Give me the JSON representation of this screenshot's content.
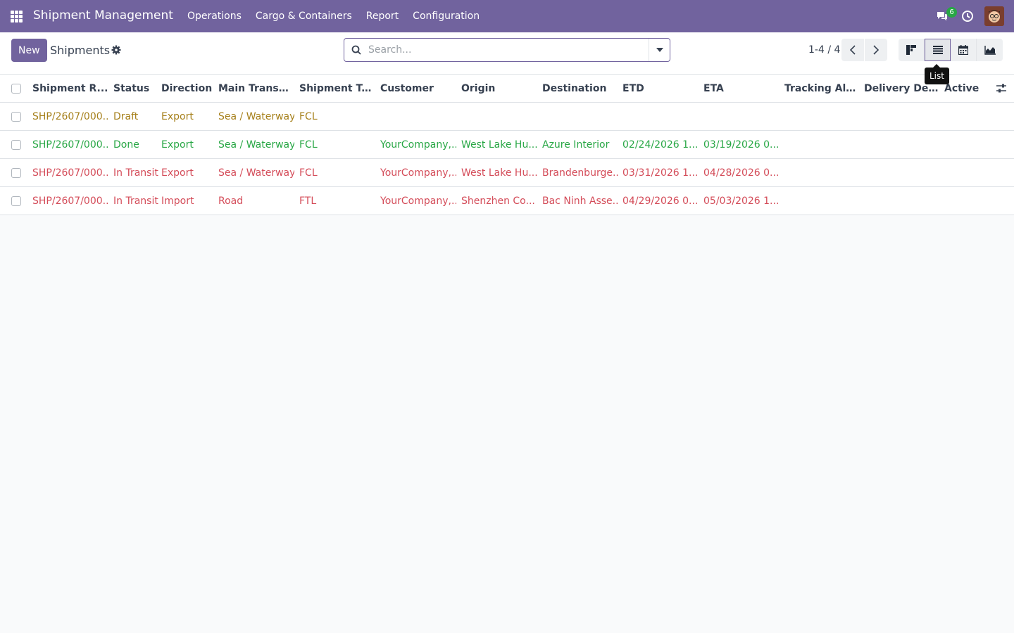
{
  "navbar": {
    "brand": "Shipment Management",
    "menu": [
      "Operations",
      "Cargo & Containers",
      "Report",
      "Configuration"
    ],
    "chat_badge": "6"
  },
  "control": {
    "new_label": "New",
    "title": "Shipments",
    "search_placeholder": "Search...",
    "pager": "1-4 / 4",
    "tooltip": "List"
  },
  "table": {
    "columns": [
      "Shipment R...",
      "Status",
      "Direction",
      "Main Transp...",
      "Shipment Ty...",
      "Customer",
      "Origin",
      "Destination",
      "ETD",
      "ETA",
      "Tracking Alert",
      "Delivery Del...",
      "Active"
    ],
    "rows": [
      {
        "color": "yellow",
        "cells": [
          "SHP/2607/000...",
          "Draft",
          "Export",
          "Sea / Waterway",
          "FCL",
          "",
          "",
          "",
          "",
          "",
          "",
          "",
          ""
        ]
      },
      {
        "color": "green",
        "cells": [
          "SHP/2607/000...",
          "Done",
          "Export",
          "Sea / Waterway",
          "FCL",
          "YourCompany,...",
          "West Lake Hu...",
          "Azure Interior",
          "02/24/2026 1...",
          "03/19/2026 0...",
          "",
          "",
          ""
        ]
      },
      {
        "color": "red",
        "cells": [
          "SHP/2607/000...",
          "In Transit",
          "Export",
          "Sea / Waterway",
          "FCL",
          "YourCompany,...",
          "West Lake Hu...",
          "Brandenburge...",
          "03/31/2026 1...",
          "04/28/2026 0...",
          "",
          "",
          ""
        ]
      },
      {
        "color": "red",
        "cells": [
          "SHP/2607/000...",
          "In Transit",
          "Import",
          "Road",
          "FTL",
          "YourCompany,...",
          "Shenzhen Co...",
          "Bac Ninh Asse...",
          "04/29/2026 0...",
          "05/03/2026 1...",
          "",
          "",
          ""
        ]
      }
    ]
  }
}
